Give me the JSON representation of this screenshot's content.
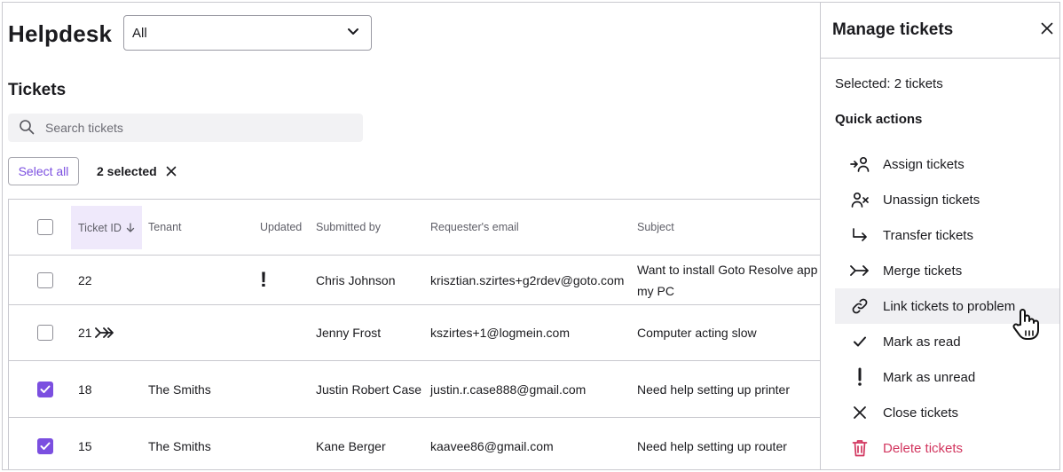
{
  "app": {
    "title": "Helpdesk"
  },
  "filter": {
    "value": "All"
  },
  "tickets": {
    "title": "Tickets",
    "search_placeholder": "Search tickets",
    "select_all_label": "Select all",
    "selected_label": "2 selected"
  },
  "table": {
    "headers": [
      "Ticket ID",
      "Tenant",
      "Updated",
      "Submitted by",
      "Requester's email",
      "Subject"
    ],
    "sort_icon": "arrow-down-icon",
    "rows": [
      {
        "id": "22",
        "tenant": "",
        "updated": "!",
        "submitted_by": "Chris Johnson",
        "email": "krisztian.szirtes+g2rdev@goto.com",
        "subject": "Want to install Goto Resolve app my PC",
        "checked": false
      },
      {
        "id": "21",
        "tenant": "",
        "updated": "",
        "submitted_by": "Jenny Frost",
        "email": "kszirtes+1@logmein.com",
        "subject": "Computer acting slow",
        "checked": false,
        "icon": "merge-icon"
      },
      {
        "id": "18",
        "tenant": "The Smiths",
        "updated": "",
        "submitted_by": "Justin Robert Case",
        "email": "justin.r.case888@gmail.com",
        "subject": "Need help setting up printer",
        "checked": true
      },
      {
        "id": "15",
        "tenant": "The Smiths",
        "updated": "",
        "submitted_by": "Kane Berger",
        "email": "kaavee86@gmail.com",
        "subject": "Need help setting up router",
        "checked": true
      }
    ]
  },
  "panel": {
    "title": "Manage tickets",
    "selected_text": "Selected: 2 tickets",
    "quick_actions_title": "Quick actions",
    "actions": [
      {
        "label": "Assign tickets",
        "icon": "assign-icon"
      },
      {
        "label": "Unassign tickets",
        "icon": "unassign-icon"
      },
      {
        "label": "Transfer tickets",
        "icon": "transfer-icon"
      },
      {
        "label": "Merge tickets",
        "icon": "merge-icon"
      },
      {
        "label": "Link tickets to problem",
        "icon": "link-icon"
      },
      {
        "label": "Mark as read",
        "icon": "check-icon"
      },
      {
        "label": "Mark as unread",
        "icon": "exclamation-icon"
      },
      {
        "label": "Close tickets",
        "icon": "close-icon"
      },
      {
        "label": "Delete tickets",
        "icon": "trash-icon"
      }
    ],
    "danger_color": "#d2365f"
  },
  "colors": {
    "accent": "#7b4fe0",
    "sort_highlight": "#efe9fb"
  }
}
